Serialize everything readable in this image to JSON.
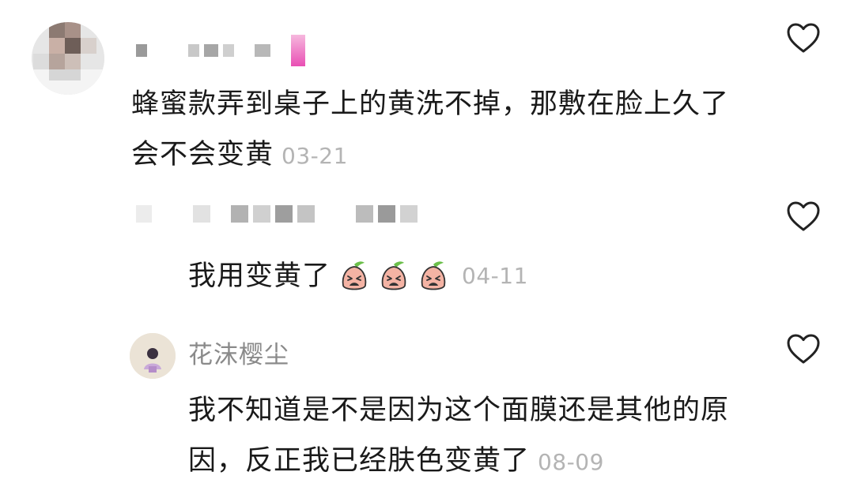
{
  "comments": [
    {
      "username": "",
      "text": "蜂蜜款弄到桌子上的黄洗不掉，那敷在脸上久了会不会变黄",
      "time": "03-21",
      "like_icon": "heart-outline-icon"
    }
  ],
  "replies": [
    {
      "username": "",
      "text": "我用变黄了",
      "emoji": [
        "peach-crying-emoji",
        "peach-crying-emoji",
        "peach-crying-emoji"
      ],
      "time": "04-11",
      "like_icon": "heart-outline-icon"
    },
    {
      "username": "花沫樱尘",
      "text": "我不知道是不是因为这个面膜还是其他的原因，反正我已经肤色变黄了",
      "time": "08-09",
      "like_icon": "heart-outline-icon"
    }
  ],
  "colors": {
    "text": "#1a1a1a",
    "meta": "#b4b4b4",
    "username": "#8a8a8a",
    "emoji_fill": "#f4b3a4"
  }
}
